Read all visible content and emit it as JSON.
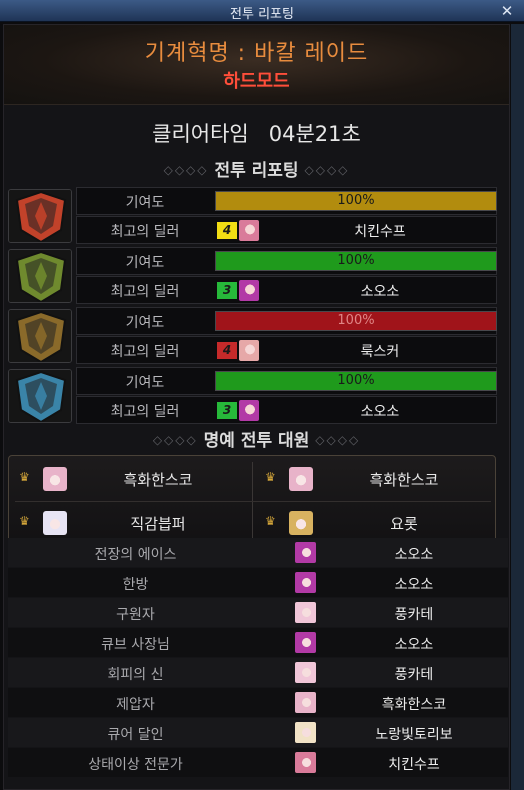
{
  "window": {
    "title": "전투 리포팅",
    "close": "✕"
  },
  "header": {
    "raid_name": "기계혁명 : 바칼 레이드",
    "mode": "하드모드"
  },
  "clear_time": {
    "label": "클리어타임",
    "value": "04분21초"
  },
  "report_section": {
    "title": "전투 리포팅",
    "orn_left": "◇◇◇◇",
    "orn_right": "◇◇◇◇"
  },
  "teams": [
    {
      "contribution_label": "기여도",
      "contribution_pct": "100%",
      "contribution_value": 100,
      "bar_color": "#b28c0e",
      "dealer_label": "최고의 딜러",
      "rank": "4",
      "rank_color": "#f2dd14",
      "dealer": "치킨수프",
      "emblem_color": "#c2422a",
      "emblem_icon": "fire-emblem",
      "face_color": "#d97b9a"
    },
    {
      "contribution_label": "기여도",
      "contribution_pct": "100%",
      "contribution_value": 100,
      "bar_color": "#1f9a1c",
      "dealer_label": "최고의 딜러",
      "rank": "3",
      "rank_color": "#27b93a",
      "dealer": "소오소",
      "emblem_color": "#6f8a2e",
      "emblem_icon": "earth-emblem",
      "face_color": "#b23aa6"
    },
    {
      "contribution_label": "기여도",
      "contribution_pct": "100%",
      "contribution_value": 100,
      "bar_color": "#a0141a",
      "dealer_label": "최고의 딜러",
      "rank": "4",
      "rank_color": "#c62a2a",
      "dealer": "룩스커",
      "emblem_color": "#8a6a2a",
      "emblem_icon": "metal-emblem",
      "face_color": "#e6a8a8"
    },
    {
      "contribution_label": "기여도",
      "contribution_pct": "100%",
      "contribution_value": 100,
      "bar_color": "#1f9a1c",
      "dealer_label": "최고의 딜러",
      "rank": "3",
      "rank_color": "#27b93a",
      "dealer": "소오소",
      "emblem_color": "#3a84a8",
      "emblem_icon": "ice-emblem",
      "face_color": "#b23aa6"
    }
  ],
  "honor_section": {
    "title": "명예 전투 대원",
    "orn_left": "◇◇◇◇",
    "orn_right": "◇◇◇◇",
    "members": [
      {
        "name": "흑화한스코",
        "face_color": "#e8b3c9"
      },
      {
        "name": "흑화한스코",
        "face_color": "#e8b3c9"
      },
      {
        "name": "직감븝퍼",
        "face_color": "#e7e4f4"
      },
      {
        "name": "요롯",
        "face_color": "#d8b260"
      }
    ]
  },
  "awards": [
    {
      "title": "전장의 에이스",
      "player": "소오소",
      "face_color": "#b23aa6"
    },
    {
      "title": "한방",
      "player": "소오소",
      "face_color": "#b23aa6"
    },
    {
      "title": "구원자",
      "player": "풍카테",
      "face_color": "#f0c6d8"
    },
    {
      "title": "큐브 사장님",
      "player": "소오소",
      "face_color": "#b23aa6"
    },
    {
      "title": "회피의 신",
      "player": "풍카테",
      "face_color": "#f0c6d8"
    },
    {
      "title": "제압자",
      "player": "흑화한스코",
      "face_color": "#e8b3c9"
    },
    {
      "title": "큐어 달인",
      "player": "노랑빛토리보",
      "face_color": "#f1e2c6"
    },
    {
      "title": "상태이상 전문가",
      "player": "치킨수프",
      "face_color": "#d97b9a"
    }
  ]
}
